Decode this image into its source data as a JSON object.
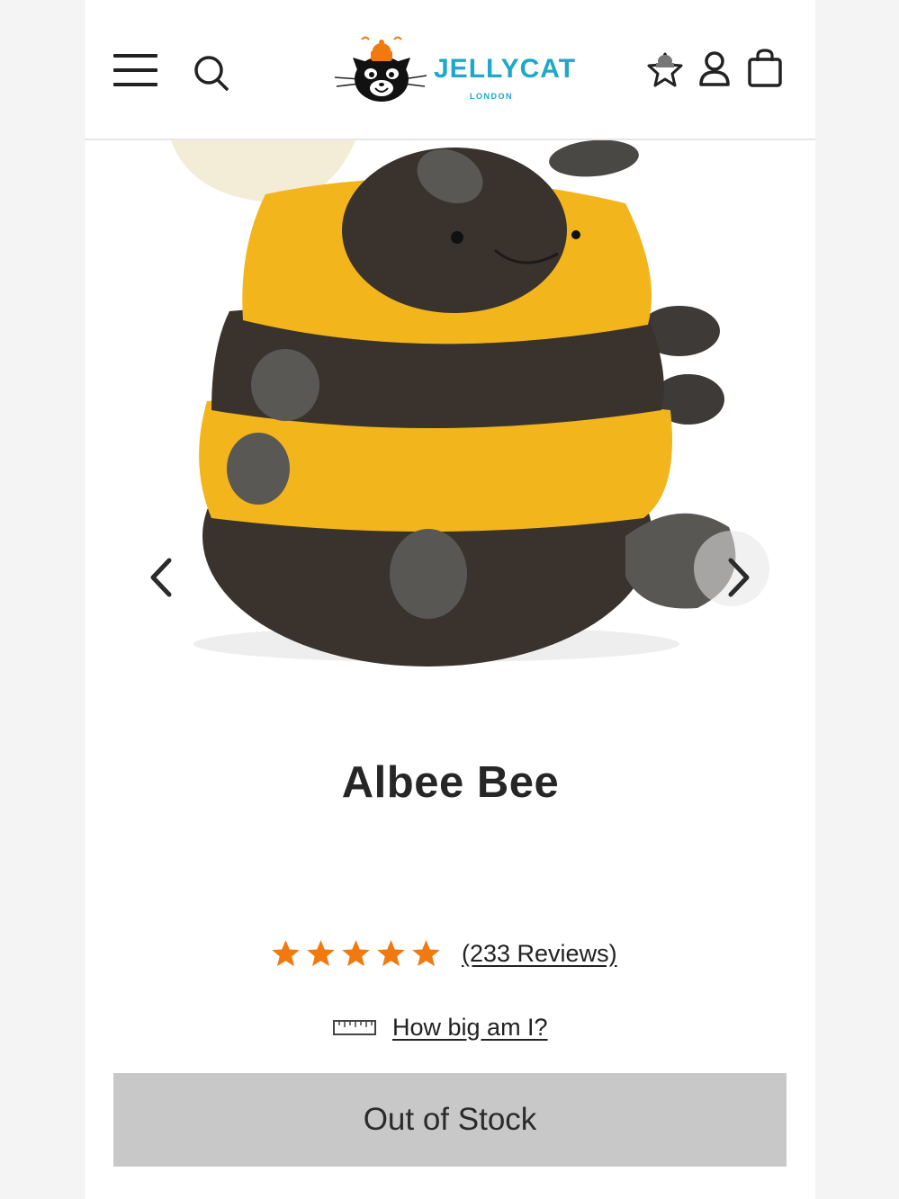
{
  "header": {
    "menu_icon": "hamburger-menu-icon",
    "search_icon": "search-icon",
    "logo_text": "JELLYCAT",
    "logo_subtext": "LONDON",
    "wishlist_icon": "star-wishlist-icon",
    "account_icon": "account-person-icon",
    "bag_icon": "shopping-bag-icon"
  },
  "gallery": {
    "prev_icon": "chevron-left-icon",
    "next_icon": "chevron-right-icon"
  },
  "product": {
    "title": "Albee Bee",
    "rating_stars": 5,
    "reviews_label": "(233 Reviews)",
    "size_label": "How big am I?",
    "stock_button_label": "Out of Stock"
  },
  "colors": {
    "star": "#f07a10",
    "bee_yellow": "#f2b51c",
    "bee_brown": "#3a332d",
    "button_bg": "#c8c8c8"
  }
}
